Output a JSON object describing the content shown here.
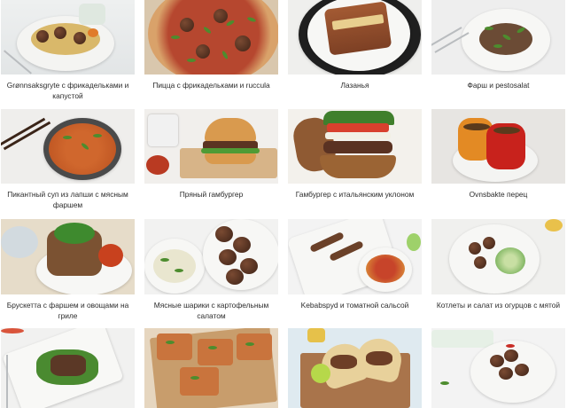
{
  "recipes": [
    {
      "title": "Grønnsaksgryte с фрикадельками и капустой"
    },
    {
      "title": "Пицца с фрикадельками и ruccula"
    },
    {
      "title": "Лазанья"
    },
    {
      "title": "Фарш и pestosalat"
    },
    {
      "title": "Пикантный суп из лапши с мясным фаршем"
    },
    {
      "title": "Пряный гамбургер"
    },
    {
      "title": "Гамбургер с итальянским уклоном"
    },
    {
      "title": "Ovnsbakte перец"
    },
    {
      "title": "Брускетта с фаршем и овощами на гриле"
    },
    {
      "title": "Мясные шарики с картофельным салатом"
    },
    {
      "title": "Kebabspyd и томатной сальсой"
    },
    {
      "title": "Котлеты и салат из огурцов с мятой"
    }
  ],
  "colors": {
    "background": "#ffffff",
    "caption_text": "#2b2b2b",
    "photo_light_bg": "#eeeeec",
    "photo_wood_bg": "#e9dcc6"
  }
}
